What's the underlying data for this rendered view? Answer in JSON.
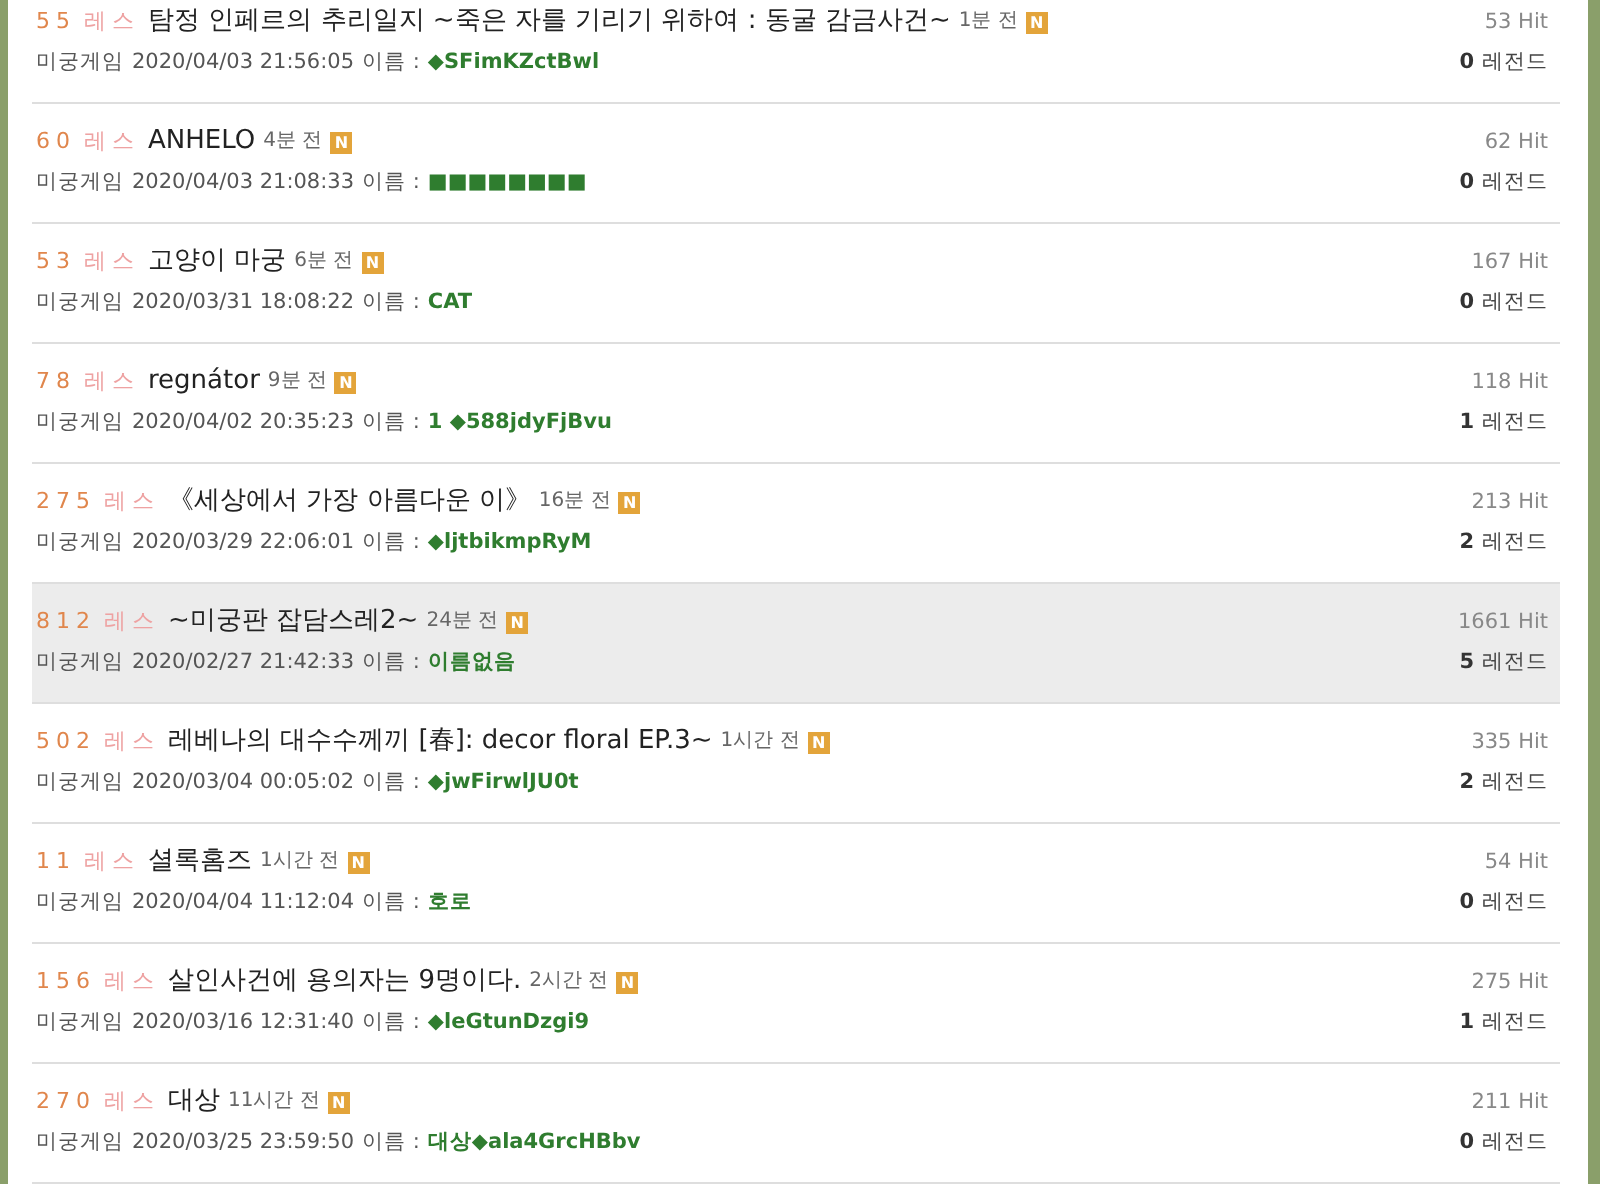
{
  "threads": [
    {
      "res_count": "55",
      "res_label": "레스",
      "title": "탐정 인페르의 추리일지 ~죽은 자를 기리기 위하여 : 동굴 감금사건~",
      "ago": "1분 전",
      "new_badge": "N",
      "board": "미궁게임",
      "date": "2020/04/03 21:56:05",
      "name_label": "이름 :",
      "name": "◆SFimKZctBwl",
      "hits": "53 Hit",
      "legend_count": "0",
      "legend_label": "레전드",
      "highlighted": false
    },
    {
      "res_count": "60",
      "res_label": "레스",
      "title": "ANHELO",
      "ago": "4분 전",
      "new_badge": "N",
      "board": "미궁게임",
      "date": "2020/04/03 21:08:33",
      "name_label": "이름 :",
      "name": "■■■■■■■■",
      "hits": "62 Hit",
      "legend_count": "0",
      "legend_label": "레전드",
      "highlighted": false
    },
    {
      "res_count": "53",
      "res_label": "레스",
      "title": "고양이 마궁",
      "ago": "6분 전",
      "new_badge": "N",
      "board": "미궁게임",
      "date": "2020/03/31 18:08:22",
      "name_label": "이름 :",
      "name": "CAT",
      "hits": "167 Hit",
      "legend_count": "0",
      "legend_label": "레전드",
      "highlighted": false
    },
    {
      "res_count": "78",
      "res_label": "레스",
      "title": "regnátor",
      "ago": "9분 전",
      "new_badge": "N",
      "board": "미궁게임",
      "date": "2020/04/02 20:35:23",
      "name_label": "이름 :",
      "name": "1 ◆588jdyFjBvu",
      "hits": "118 Hit",
      "legend_count": "1",
      "legend_label": "레전드",
      "highlighted": false
    },
    {
      "res_count": "275",
      "res_label": "레스",
      "title": "《세상에서 가장 아름다운 이》",
      "ago": "16분 전",
      "new_badge": "N",
      "board": "미궁게임",
      "date": "2020/03/29 22:06:01",
      "name_label": "이름 :",
      "name": "◆ljtbikmpRyM",
      "hits": "213 Hit",
      "legend_count": "2",
      "legend_label": "레전드",
      "highlighted": false
    },
    {
      "res_count": "812",
      "res_label": "레스",
      "title": "~미궁판 잡담스레2~",
      "ago": "24분 전",
      "new_badge": "N",
      "board": "미궁게임",
      "date": "2020/02/27 21:42:33",
      "name_label": "이름 :",
      "name": "이름없음",
      "hits": "1661 Hit",
      "legend_count": "5",
      "legend_label": "레전드",
      "highlighted": true
    },
    {
      "res_count": "502",
      "res_label": "레스",
      "title": "레베나의 대수수께끼 [春]: decor floral EP.3~",
      "ago": "1시간 전",
      "new_badge": "N",
      "board": "미궁게임",
      "date": "2020/03/04 00:05:02",
      "name_label": "이름 :",
      "name": "◆jwFirwlJU0t",
      "hits": "335 Hit",
      "legend_count": "2",
      "legend_label": "레전드",
      "highlighted": false
    },
    {
      "res_count": "11",
      "res_label": "레스",
      "title": "셜록홈즈",
      "ago": "1시간 전",
      "new_badge": "N",
      "board": "미궁게임",
      "date": "2020/04/04 11:12:04",
      "name_label": "이름 :",
      "name": "호로",
      "hits": "54 Hit",
      "legend_count": "0",
      "legend_label": "레전드",
      "highlighted": false
    },
    {
      "res_count": "156",
      "res_label": "레스",
      "title": "살인사건에 용의자는 9명이다.",
      "ago": "2시간 전",
      "new_badge": "N",
      "board": "미궁게임",
      "date": "2020/03/16 12:31:40",
      "name_label": "이름 :",
      "name": "◆leGtunDzgi9",
      "hits": "275 Hit",
      "legend_count": "1",
      "legend_label": "레전드",
      "highlighted": false
    },
    {
      "res_count": "270",
      "res_label": "레스",
      "title": "대상",
      "ago": "11시간 전",
      "new_badge": "N",
      "board": "미궁게임",
      "date": "2020/03/25 23:59:50",
      "name_label": "이름 :",
      "name": "대상◆ala4GrcHBbv",
      "hits": "211 Hit",
      "legend_count": "0",
      "legend_label": "레전드",
      "highlighted": false
    }
  ]
}
